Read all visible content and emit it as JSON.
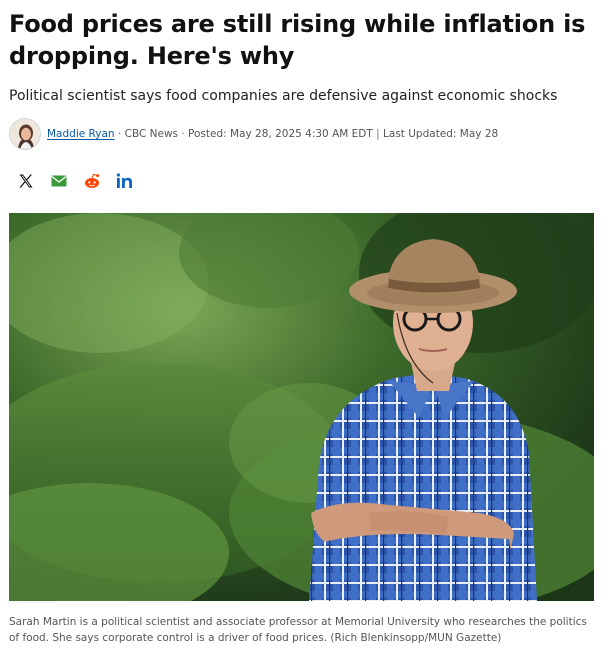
{
  "article": {
    "headline": "Food prices are still rising while inflation is dropping. Here's why",
    "dek": "Political scientist says food companies are defensive against economic shocks"
  },
  "byline": {
    "author": "Maddie Ryan",
    "separator": "·",
    "outlet": "CBC News",
    "posted": "Posted: May 28, 2025 4:30 AM EDT",
    "divider": "|",
    "updated": "Last Updated: May 28"
  },
  "share": [
    {
      "icon": "x-icon",
      "label": "X"
    },
    {
      "icon": "email-icon",
      "label": "Email"
    },
    {
      "icon": "reddit-icon",
      "label": "Reddit"
    },
    {
      "icon": "linkedin-icon",
      "label": "in"
    }
  ],
  "photo": {
    "caption": "Sarah Martin is a political scientist and associate professor at Memorial University who researches the politics of food. She says corporate control is a driver of food prices. (Rich Blenkinsopp/MUN Gazette)"
  },
  "colors": {
    "link": "#0a58a6",
    "email": "#3a9a3a",
    "reddit": "#ff4500",
    "linkedin": "#0a66c2"
  }
}
